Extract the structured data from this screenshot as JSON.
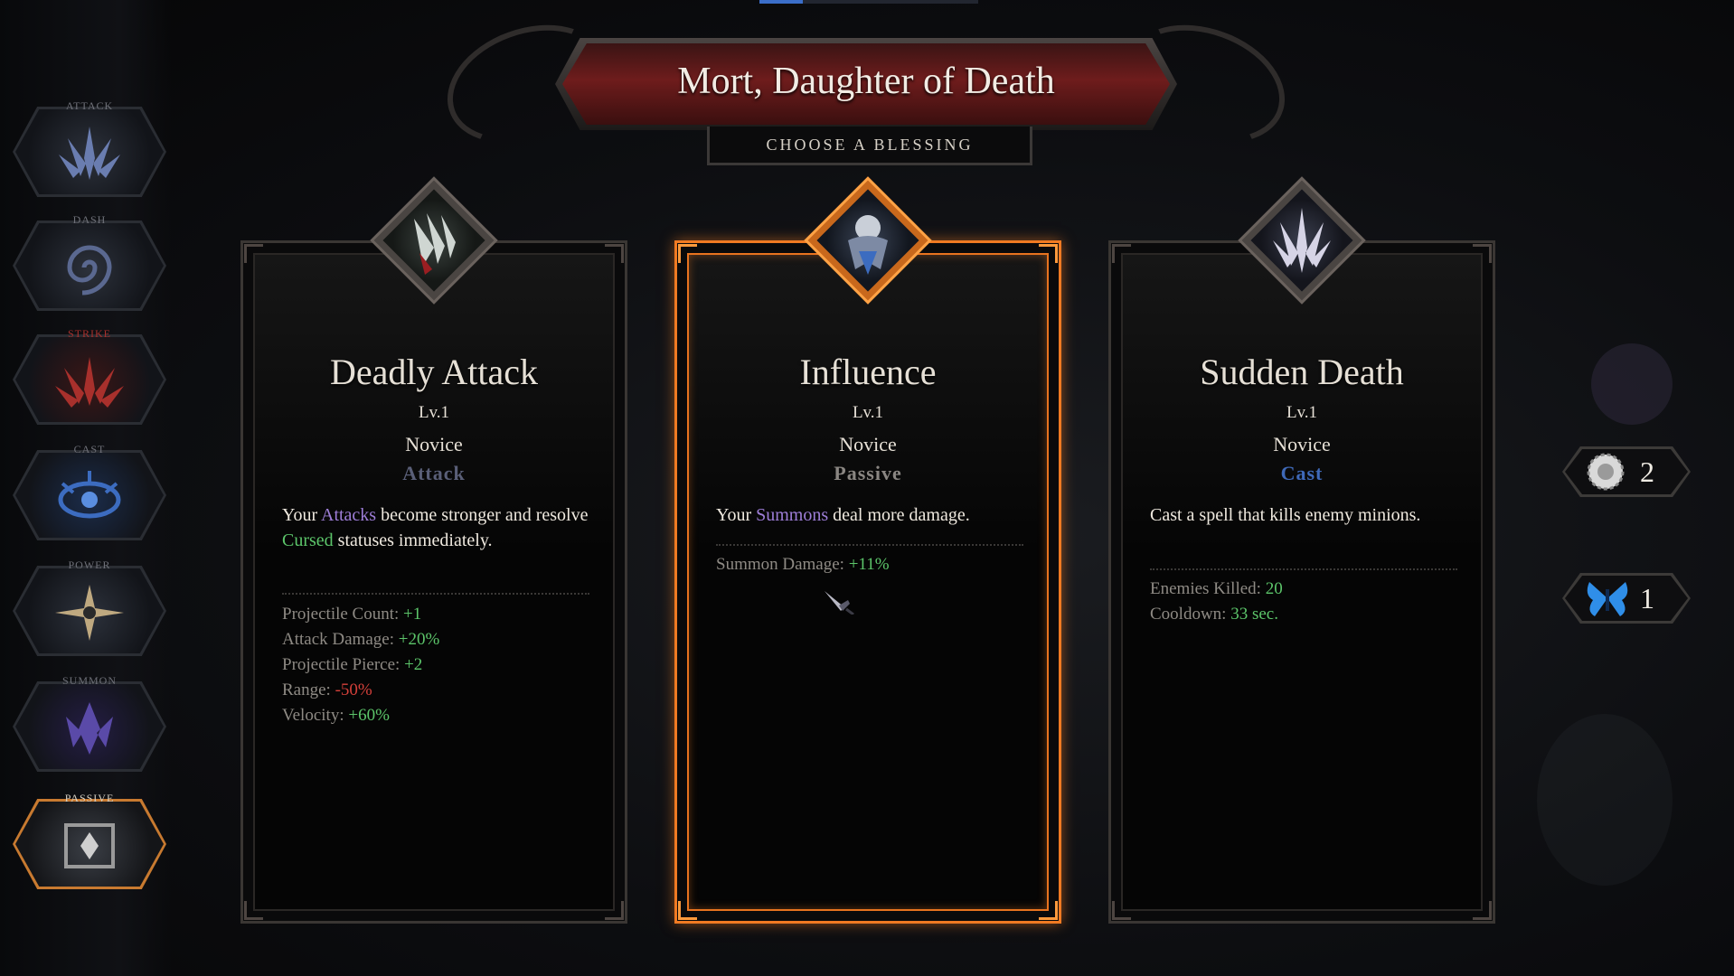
{
  "banner": {
    "title": "Mort, Daughter of Death",
    "subtitle": "CHOOSE A BLESSING"
  },
  "skill_rail": [
    {
      "label": "ATTACK",
      "icon": "attack-claw-icon",
      "color": "#6a7db0"
    },
    {
      "label": "DASH",
      "icon": "dash-swirl-icon",
      "color": "#5a6890"
    },
    {
      "label": "STRIKE",
      "icon": "strike-claw-icon",
      "color": "#a8302c"
    },
    {
      "label": "CAST",
      "icon": "cast-eye-icon",
      "color": "#3c6cc0"
    },
    {
      "label": "POWER",
      "icon": "power-star-icon",
      "color": "#bfa980"
    },
    {
      "label": "SUMMON",
      "icon": "summon-shard-icon",
      "color": "#5a4aa8"
    },
    {
      "label": "PASSIVE",
      "icon": "passive-rune-icon",
      "color": "#9a9a9a",
      "active": true
    }
  ],
  "cards": [
    {
      "name": "Deadly Attack",
      "level": "Lv.1",
      "rank": "Novice",
      "type": "Attack",
      "type_color": "#5a5f78",
      "icon": "deadly-attack-claw-icon",
      "desc": {
        "p1": "Your ",
        "h1": "Attacks",
        "p2": " become stronger and resolve ",
        "h2": "Cursed",
        "p3": " statuses immediately."
      },
      "stats": [
        {
          "label": "Projectile Count: ",
          "value": "+1",
          "tone": "green"
        },
        {
          "label": "Attack Damage: ",
          "value": "+20%",
          "tone": "green"
        },
        {
          "label": "Projectile Pierce: ",
          "value": "+2",
          "tone": "green"
        },
        {
          "label": "Range: ",
          "value": "-50%",
          "tone": "red"
        },
        {
          "label": "Velocity: ",
          "value": "+60%",
          "tone": "green"
        }
      ]
    },
    {
      "name": "Influence",
      "level": "Lv.1",
      "rank": "Novice",
      "type": "Passive",
      "type_color": "#8a8682",
      "icon": "influence-summon-icon",
      "selected": true,
      "desc": {
        "p1": "Your ",
        "h1": "Summons",
        "p2": " deal more damage."
      },
      "stats": [
        {
          "label": "Summon Damage: ",
          "value": "+11%",
          "tone": "green"
        }
      ]
    },
    {
      "name": "Sudden Death",
      "level": "Lv.1",
      "rank": "Novice",
      "type": "Cast",
      "type_color": "#3f69b8",
      "icon": "sudden-death-claw-icon",
      "desc": {
        "p1": "Cast a spell that kills enemy minions."
      },
      "stats": [
        {
          "label": "Enemies Killed: ",
          "value": "20",
          "tone": "green"
        },
        {
          "label": "Cooldown: ",
          "value": "33 sec.",
          "tone": "green"
        }
      ]
    }
  ],
  "counters": [
    {
      "icon": "reroll-orb-icon",
      "count": "2"
    },
    {
      "icon": "butterfly-icon",
      "count": "1"
    }
  ]
}
